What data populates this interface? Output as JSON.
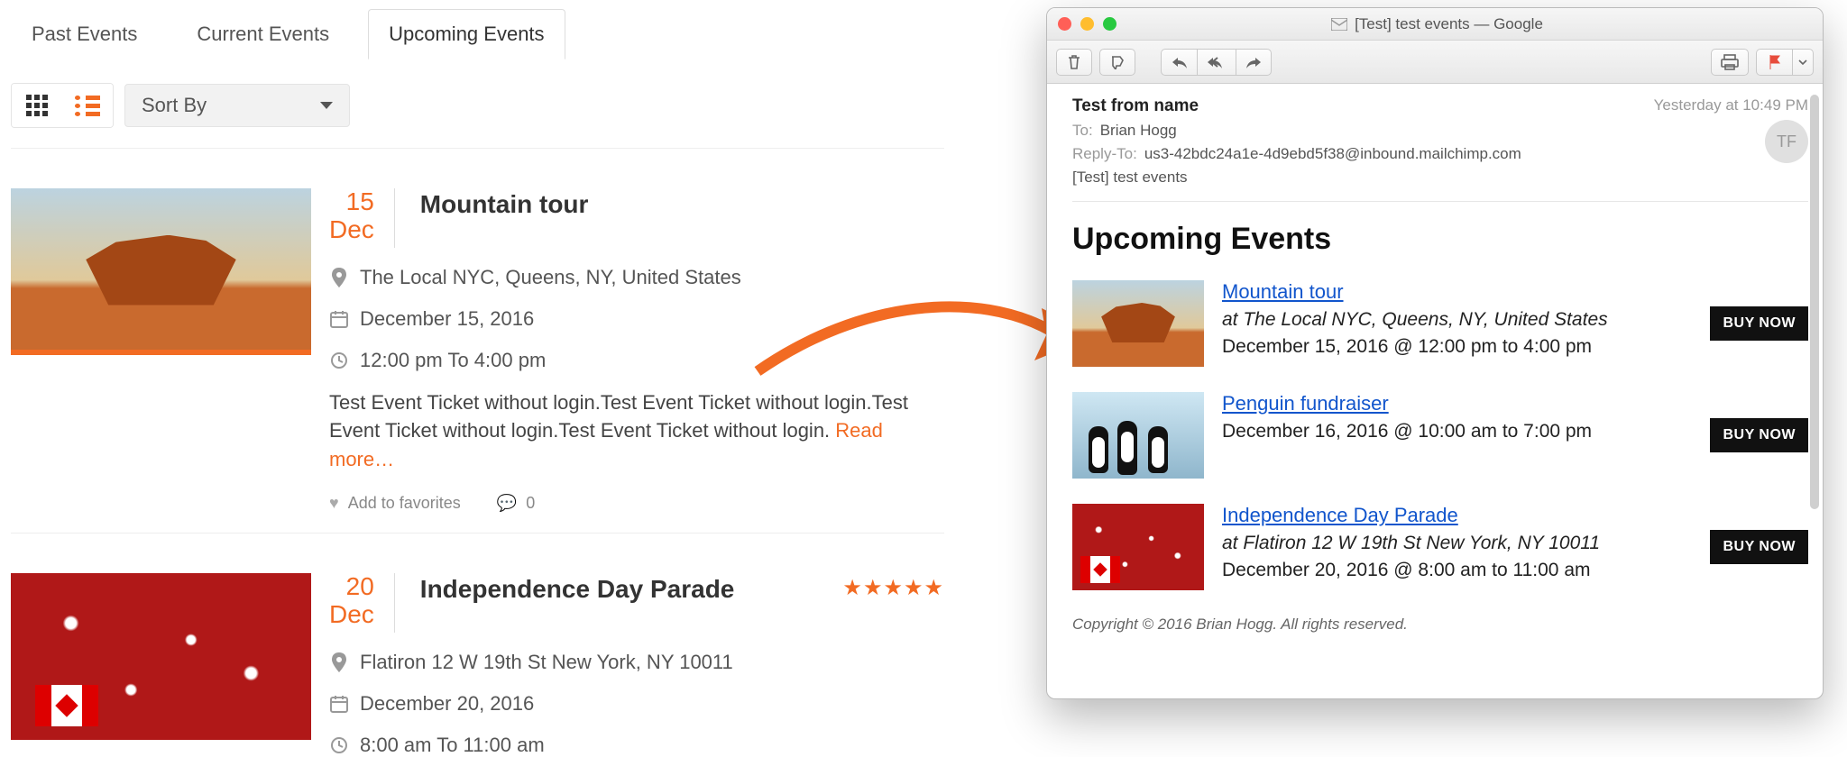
{
  "tabs": {
    "past": "Past Events",
    "current": "Current Events",
    "upcoming": "Upcoming Events"
  },
  "sort_by_label": "Sort By",
  "events": [
    {
      "day": "15",
      "mon": "Dec",
      "title": "Mountain tour",
      "location": "The Local NYC, Queens, NY, United States",
      "date": "December 15, 2016",
      "time": "12:00 pm To 4:00 pm",
      "desc": "Test Event Ticket without login.Test Event Ticket without login.Test Event Ticket without login.Test Event Ticket without login.",
      "read_more": "Read more…",
      "favorite_label": "Add to favorites",
      "comment_count": "0",
      "stars": 0
    },
    {
      "day": "20",
      "mon": "Dec",
      "title": "Independence Day Parade",
      "location": "Flatiron 12 W 19th St New York, NY 10011",
      "date": "December 20, 2016",
      "time": "8:00 am To 11:00 am",
      "stars": 5
    }
  ],
  "mail": {
    "window_title": "[Test] test events — Google",
    "from": "Test from name",
    "to_label": "To:",
    "to": "Brian Hogg",
    "reply_label": "Reply-To:",
    "reply": "us3-42bdc24a1e-4d9ebd5f38@inbound.mailchimp.com",
    "subject": "[Test] test events",
    "timestamp": "Yesterday at 10:49 PM",
    "avatar": "TF",
    "heading": "Upcoming Events",
    "buy_label": "BUY NOW",
    "items": [
      {
        "title": "Mountain tour",
        "location": "at The Local NYC, Queens, NY, United States",
        "date": "December 15, 2016 @ 12:00 pm to 4:00 pm"
      },
      {
        "title": "Penguin fundraiser",
        "location": "",
        "date": "December 16, 2016 @ 10:00 am to 7:00 pm"
      },
      {
        "title": "Independence Day Parade",
        "location": "at Flatiron 12 W 19th St New York, NY 10011",
        "date": "December 20, 2016 @ 8:00 am to 11:00 am"
      }
    ],
    "copyright": "Copyright © 2016 Brian Hogg. All rights reserved."
  }
}
